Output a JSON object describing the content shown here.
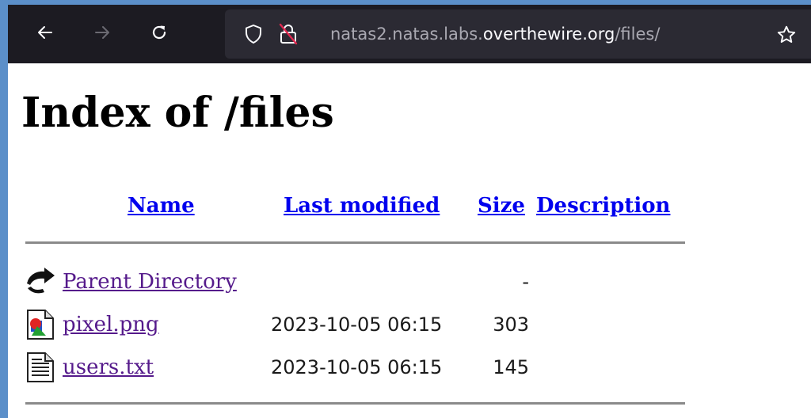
{
  "toolbar": {
    "back_icon": "arrow-left-icon",
    "forward_icon": "arrow-right-icon",
    "reload_icon": "reload-icon",
    "url": {
      "prefix": "natas2.natas.labs.",
      "domain": "overthewire.org",
      "path": "/files/"
    },
    "star_icon": "star-outline-icon"
  },
  "page": {
    "title": "Index of /files",
    "columns": {
      "name": "Name",
      "last_modified": "Last modified",
      "size": "Size",
      "description": "Description"
    },
    "rows": [
      {
        "icon": "back-arrow-icon",
        "name": "Parent Directory",
        "last_modified": "",
        "size": "-",
        "description": ""
      },
      {
        "icon": "image-file-icon",
        "name": "pixel.png",
        "last_modified": "2023-10-05 06:15",
        "size": "303",
        "description": ""
      },
      {
        "icon": "text-file-icon",
        "name": "users.txt",
        "last_modified": "2023-10-05 06:15",
        "size": "145",
        "description": ""
      }
    ]
  },
  "colors": {
    "desktop": "#5b8fc9",
    "toolbar": "#1c1b22",
    "urlbar": "#2b2a33",
    "link": "#0000ee",
    "visited_link": "#551a8b"
  }
}
